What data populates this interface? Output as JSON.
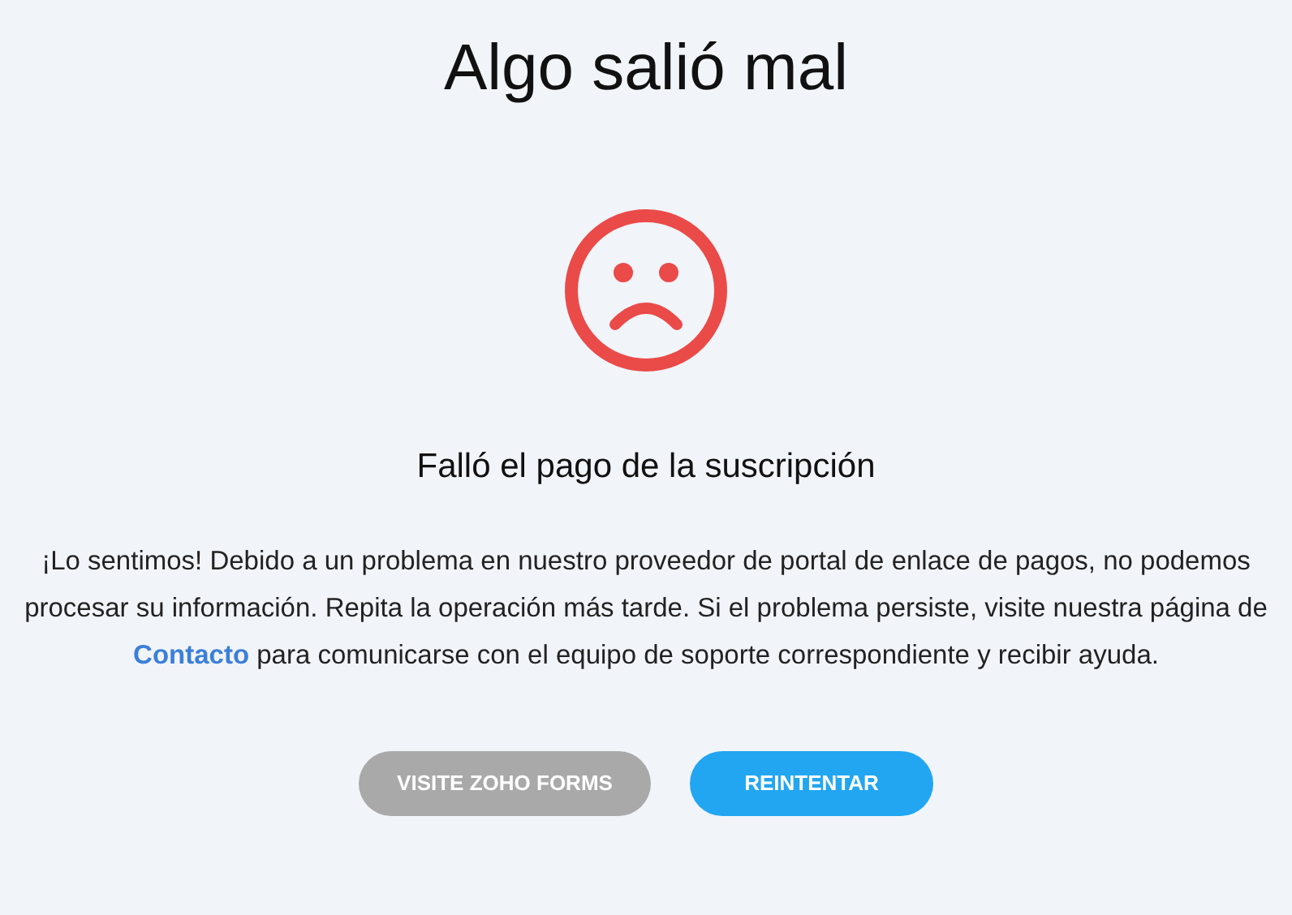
{
  "title": "Algo salió mal",
  "subtitle": "Falló el pago de la suscripción",
  "message": {
    "before": "¡Lo sentimos! Debido a un problema en nuestro proveedor de portal de enlace de pagos, no podemos procesar su información. Repita la operación más tarde. Si el problema persiste, visite nuestra página de",
    "link": "Contacto",
    "after": "para comunicarse con el equipo de soporte correspondiente y recibir ayuda."
  },
  "buttons": [
    {
      "label": "VISITE ZOHO FORMS",
      "kind": "secondary"
    },
    {
      "label": "REINTENTAR",
      "kind": "primary"
    }
  ]
}
